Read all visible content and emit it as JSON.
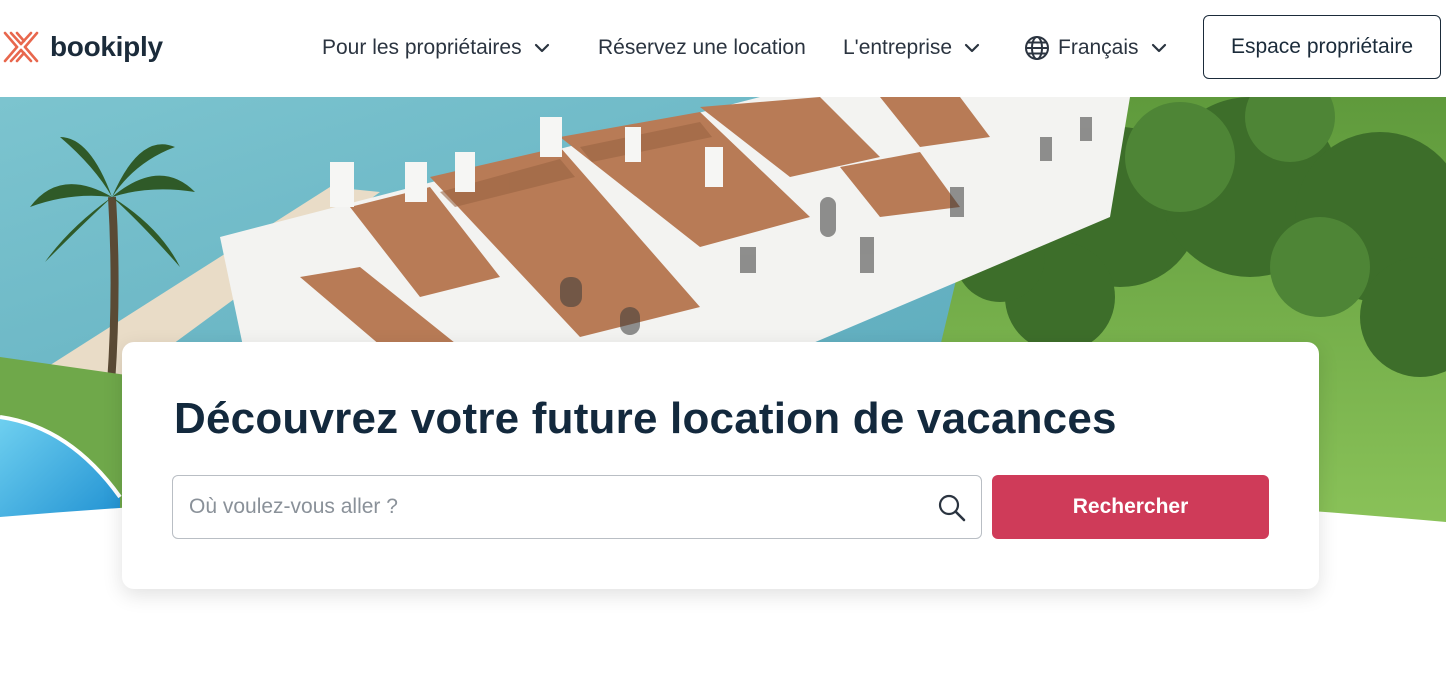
{
  "brand": {
    "name": "bookiply",
    "accent_color": "#e8674d"
  },
  "nav": {
    "owners": "Pour les propriétaires",
    "book": "Réservez une location",
    "company": "L'entreprise",
    "language": "Français",
    "owner_space": "Espace propriétaire"
  },
  "hero": {
    "headline": "Découvrez votre future location de vacances",
    "search": {
      "placeholder": "Où voulez-vous aller ?",
      "value": "",
      "button_label": "Rechercher",
      "button_color": "#cf3b59"
    }
  },
  "icons": {
    "logo": "bookiply-logo-icon",
    "chevron": "chevron-down-icon",
    "globe": "globe-icon",
    "search": "search-icon"
  }
}
